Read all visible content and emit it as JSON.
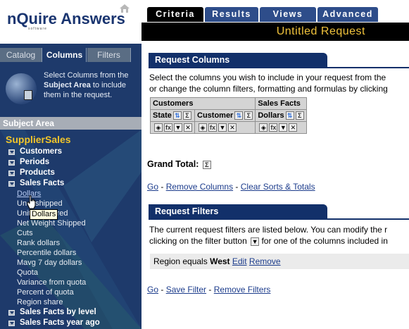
{
  "app": {
    "logo_text": "nQuire Answers",
    "logo_sub": "software"
  },
  "left_tabs": [
    "Catalog",
    "Columns",
    "Filters"
  ],
  "active_left_tab": "Columns",
  "help": {
    "text_pre": "Select Columns from the ",
    "text_bold": "Subject Area",
    "text_post": " to include them in the request."
  },
  "subject_area": {
    "header": "Subject Area",
    "name": "SupplierSales",
    "folders_top": [
      "Customers",
      "Periods",
      "Products",
      "Sales Facts"
    ],
    "sales_facts_columns": [
      "Dollars",
      "Units Shipped",
      "Units Ordered",
      "Net Weight Shipped",
      "Cuts",
      "Rank dollars",
      "Percentile dollars",
      "Mavg 7 day dollars",
      "Quota",
      "Variance from quota",
      "Percent of quota",
      "Region share"
    ],
    "sales_facts_columns_visible": [
      "Dollars",
      "Un",
      "shipped",
      "Unit",
      "red",
      "Net Weight Shipped",
      "Cuts",
      "Rank dollars",
      "Percentile dollars",
      "Mavg 7 day dollars",
      "Quota",
      "Variance from quota",
      "Percent of quota",
      "Region share"
    ],
    "folders_bottom": [
      "Sales Facts by level",
      "Sales Facts year ago"
    ],
    "tooltip": "Dollars"
  },
  "top_tabs": [
    "Criteria",
    "Results",
    "Views",
    "Advanced"
  ],
  "active_top_tab": "Criteria",
  "request_title": "Untitled Request",
  "request_columns": {
    "header": "Request Columns",
    "line1": "Select the columns you wish to include in your request from the",
    "line2": "or change the column filters, formatting and formulas by clicking",
    "groups": [
      "Customers",
      "Sales Facts"
    ],
    "columns": [
      "State",
      "Customer",
      "Dollars"
    ],
    "grand_total": "Grand Total:",
    "go": "Go",
    "remove_columns": "Remove Columns",
    "clear_sorts": "Clear Sorts & Totals",
    "sep": "-"
  },
  "request_filters": {
    "header": "Request Filters",
    "line1": "The current request filters are listed below. You can modify the r",
    "line2_pre": "clicking on the filter button",
    "line2_post": "for one of the columns included in",
    "filter_prefix": "Region equals",
    "filter_value": "West",
    "edit": "Edit",
    "remove": "Remove",
    "go": "Go",
    "save_filter": "Save Filter",
    "remove_filters": "Remove Filters",
    "sep": "-"
  },
  "colors": {
    "sidebar_bg": "#1e3a6b",
    "accent_yellow": "#f2c52a",
    "tab_blue": "#2e4d8a",
    "section_header": "#12306a"
  }
}
